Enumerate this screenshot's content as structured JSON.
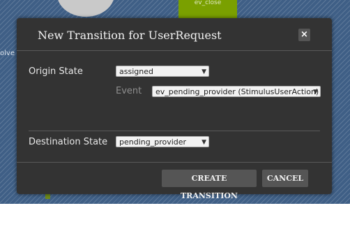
{
  "background": {
    "node_label": "ev_close",
    "side_label": "olve"
  },
  "dialog": {
    "title": "New Transition for UserRequest",
    "close_icon": "×",
    "origin_label": "Origin State",
    "origin_value": "assigned",
    "event_label": "Event",
    "event_value": "ev_pending_provider (StimulusUserAction)",
    "destination_label": "Destination State",
    "destination_value": "pending_provider",
    "create_label": "CREATE TRANSITION",
    "cancel_label": "CANCEL"
  },
  "icons": {
    "close": "close-icon",
    "dropdown": "chevron-down-icon"
  }
}
